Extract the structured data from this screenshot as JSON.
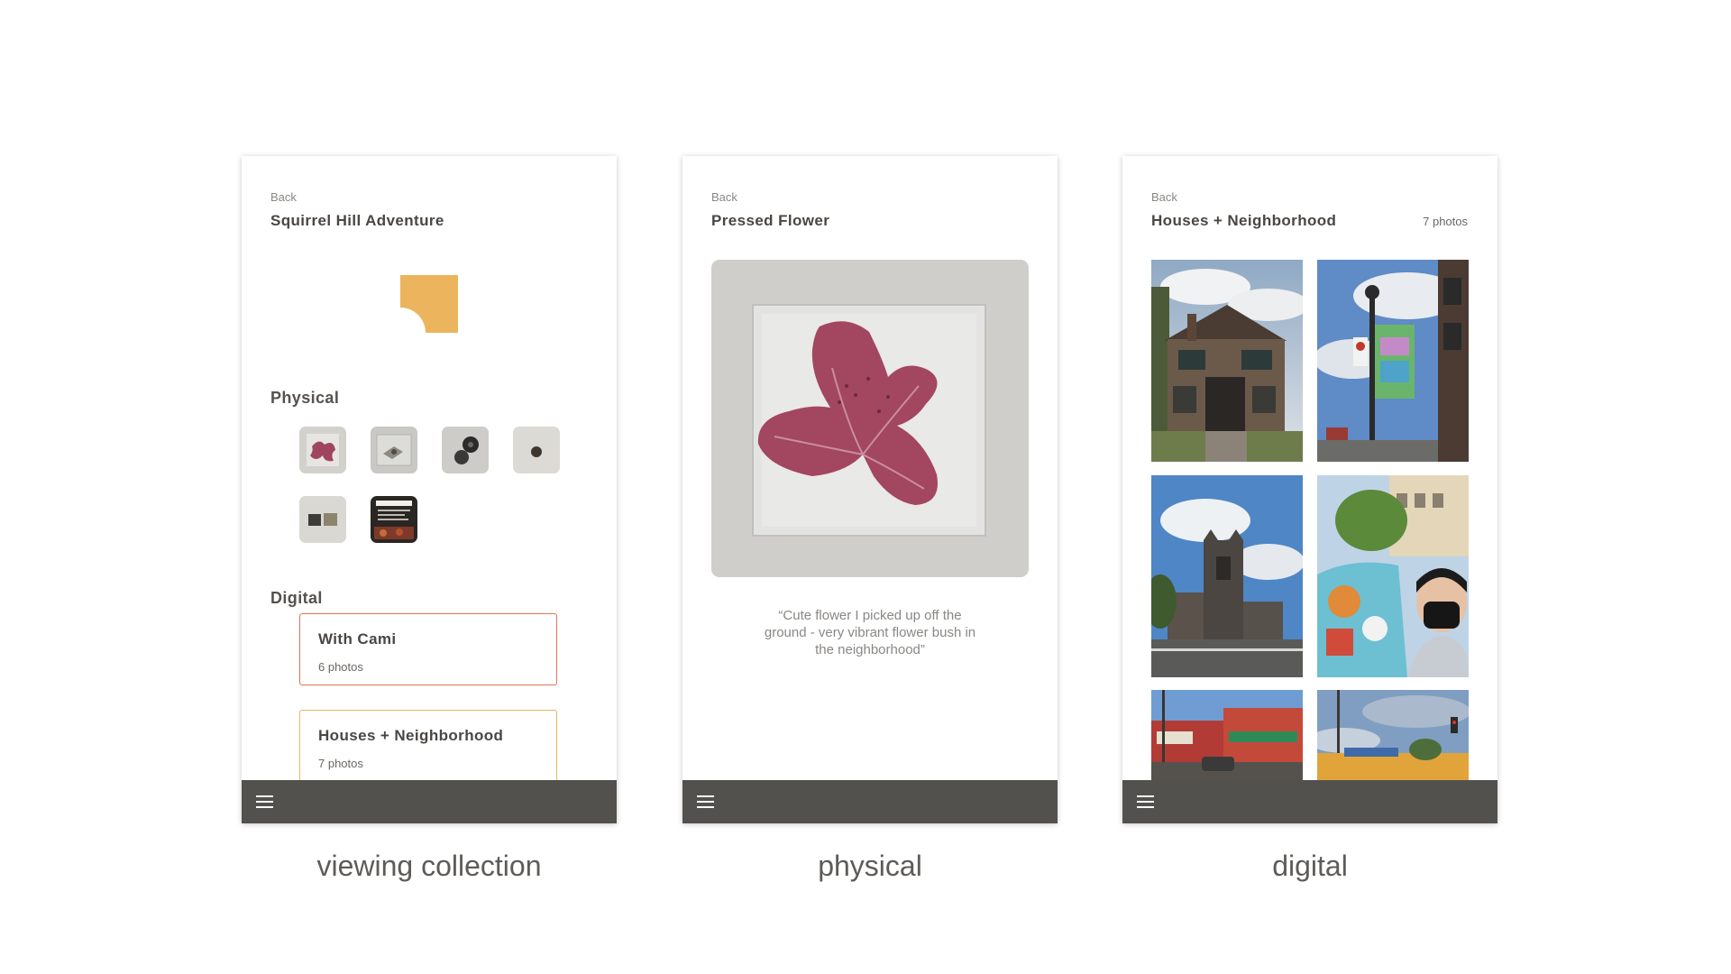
{
  "screens": [
    {
      "back_label": "Back",
      "title": "Squirrel Hill Adventure",
      "physical_heading": "Physical",
      "physical_items": [
        "pressed-flower-thumbnail",
        "wrapped-item-thumbnail",
        "buttons-thumbnail",
        "seed-thumbnail",
        "tiles-thumbnail",
        "noodles-card-thumbnail"
      ],
      "digital_heading": "Digital",
      "albums": [
        {
          "title": "With Cami",
          "count": "6 photos",
          "border_color": "#e0735a"
        },
        {
          "title": "Houses + Neighborhood",
          "count": "7 photos",
          "border_color": "#ecb55d"
        }
      ],
      "caption": "viewing collection"
    },
    {
      "back_label": "Back",
      "title": "Pressed Flower",
      "quote": "“Cute flower I picked up off the ground - very vibrant flower bush in the neighborhood”",
      "caption": "physical"
    },
    {
      "back_label": "Back",
      "title": "Houses + Neighborhood",
      "count": "7 photos",
      "photos": [
        "tudor-house-photo",
        "street-banner-photo",
        "church-tower-photo",
        "selfie-mural-photo",
        "storefront-street-photo",
        "intersection-sky-photo"
      ],
      "caption": "digital"
    }
  ],
  "colors": {
    "accent_yellow": "#ecb55d",
    "accent_red": "#e0735a",
    "bottom_bar": "#53514d"
  },
  "icons": {
    "menu": "hamburger-menu-icon"
  }
}
